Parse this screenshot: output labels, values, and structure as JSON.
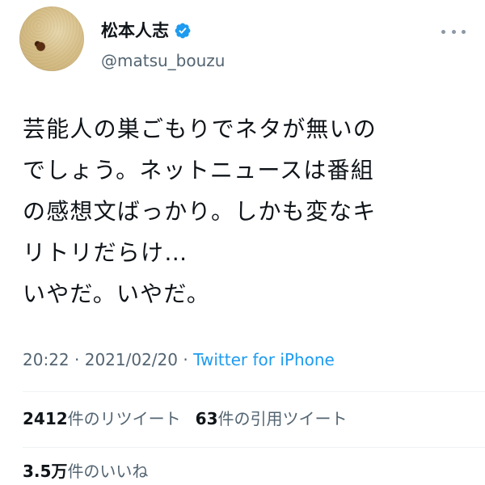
{
  "user": {
    "display_name": "松本人志",
    "handle": "@matsu_bouzu",
    "verified": true,
    "avatar": "avatar-rice-bowl"
  },
  "tweet": {
    "text": "芸能人の巣ごもりでネタが無いの\nでしょう。ネットニュースは番組\nの感想文ばっかり。しかも変なキ\nリトリだらけ…\nいやだ。いやだ。"
  },
  "meta": {
    "time": "20:22",
    "separator1": " · ",
    "date": "2021/02/20",
    "separator2": " · ",
    "source": "Twitter for iPhone"
  },
  "stats": {
    "retweets_count": "2412",
    "retweets_label": "件のリツイート",
    "quotes_count": "63",
    "quotes_label": "件の引用ツイート",
    "likes_count": "3.5万",
    "likes_label": "件のいいね"
  },
  "colors": {
    "accent": "#1d9bf0",
    "text": "#0f1419",
    "secondary": "#536471",
    "divider": "#eff3f4"
  },
  "icons": {
    "verified": "verified-badge-icon",
    "more": "more-options-icon"
  }
}
